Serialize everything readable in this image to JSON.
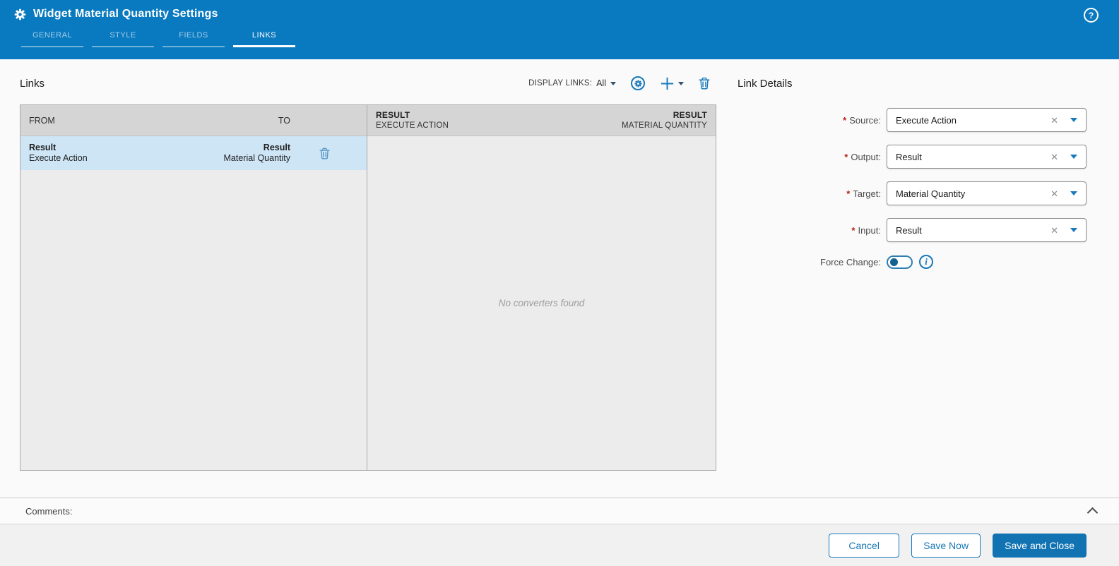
{
  "header": {
    "title": "Widget Material Quantity Settings",
    "tabs": [
      {
        "label": "GENERAL",
        "active": false
      },
      {
        "label": "STYLE",
        "active": false
      },
      {
        "label": "FIELDS",
        "active": false
      },
      {
        "label": "LINKS",
        "active": true
      }
    ]
  },
  "icons": {
    "help": "?",
    "clear": "✕",
    "info": "i"
  },
  "links_panel": {
    "title": "Links",
    "toolbar": {
      "display_links_label": "DISPLAY LINKS:",
      "display_links_value": "All"
    },
    "columns": {
      "from": "FROM",
      "to": "TO"
    },
    "rows": [
      {
        "from_primary": "Result",
        "from_secondary": "Execute Action",
        "to_primary": "Result",
        "to_secondary": "Material Quantity",
        "selected": true
      }
    ]
  },
  "converters_panel": {
    "from_header": {
      "primary": "RESULT",
      "secondary": "EXECUTE ACTION"
    },
    "to_header": {
      "primary": "RESULT",
      "secondary": "MATERIAL QUANTITY"
    },
    "empty_message": "No converters found"
  },
  "link_details": {
    "title": "Link Details",
    "required_marker": "*",
    "fields": [
      {
        "label": "Source:",
        "value": "Execute Action",
        "required": true
      },
      {
        "label": "Output:",
        "value": "Result",
        "required": true
      },
      {
        "label": "Target:",
        "value": "Material Quantity",
        "required": true
      },
      {
        "label": "Input:",
        "value": "Result",
        "required": true
      }
    ],
    "force_change": {
      "label": "Force Change:",
      "enabled": false
    }
  },
  "comments": {
    "label": "Comments:"
  },
  "footer": {
    "cancel_label": "Cancel",
    "save_now_label": "Save Now",
    "save_and_close_label": "Save and Close"
  },
  "colors": {
    "header_blue": "#0a7ac0",
    "icon_blue": "#1779ba",
    "selected_row": "#cee5f5",
    "primary_button": "#1173b2",
    "panel_bg": "#ececec",
    "table_header_bg": "#d5d5d5"
  }
}
